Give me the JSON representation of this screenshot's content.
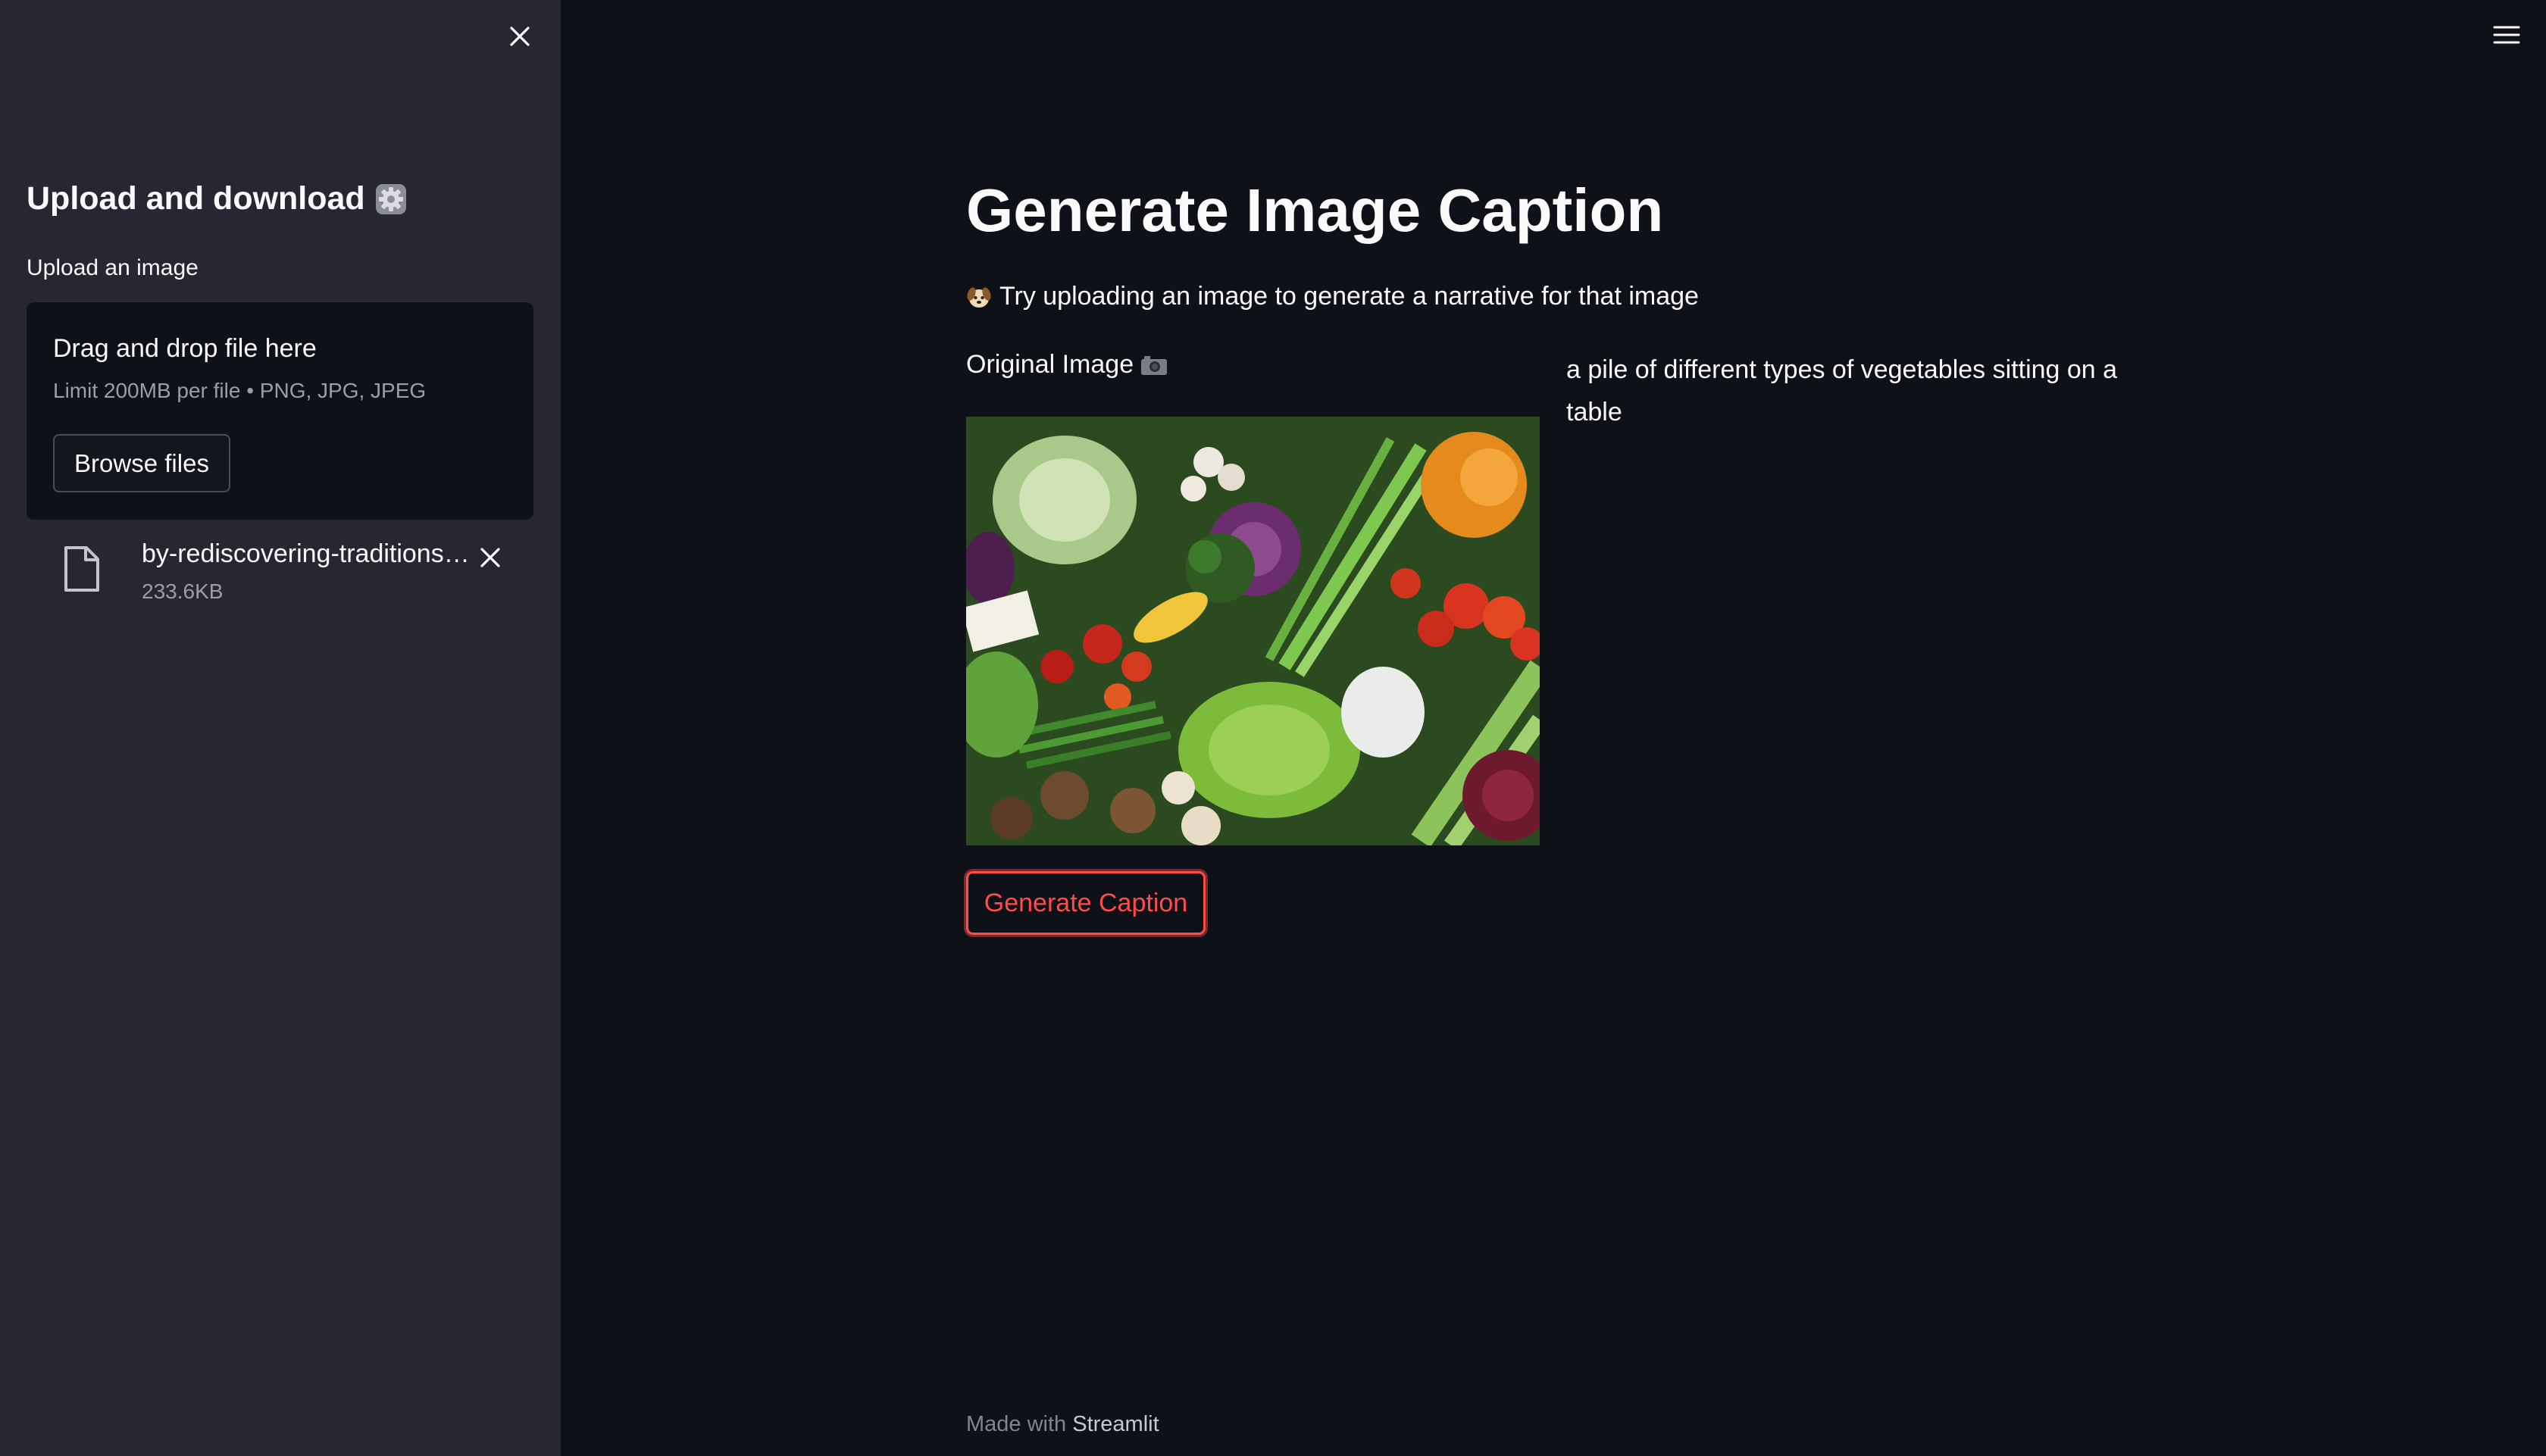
{
  "sidebar": {
    "title": "Upload and download",
    "title_icon": "gear-emoji",
    "uploader": {
      "label": "Upload an image",
      "dropzone_title": "Drag and drop file here",
      "limit_text": "Limit 200MB per file • PNG, JPG, JPEG",
      "browse_label": "Browse files"
    },
    "file": {
      "name": "by-rediscovering-traditions…",
      "size": "233.6KB",
      "icon": "file-icon"
    }
  },
  "main": {
    "title": "Generate Image Caption",
    "subtitle": "Try uploading an image to generate a narrative for that image",
    "subtitle_icon": "dog-emoji",
    "original_image_label": "Original Image",
    "original_image_icon": "camera-emoji",
    "caption": "a pile of different types of vegetables sitting on a table",
    "generate_label": "Generate Caption"
  },
  "footer": {
    "prefix": "Made with",
    "link": "Streamlit"
  },
  "colors": {
    "background": "#0e1117",
    "sidebar": "#262730",
    "accent": "#ff4b4b",
    "text": "#fafafa",
    "muted": "#9b9ea8"
  }
}
